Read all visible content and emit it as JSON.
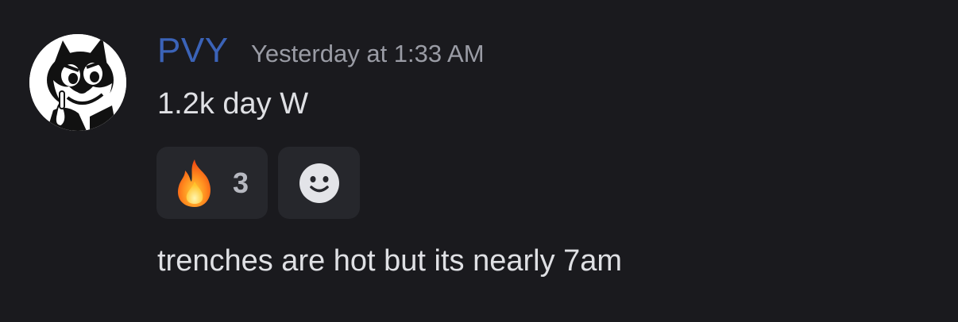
{
  "message": {
    "author": {
      "name": "PVY",
      "avatar_icon": "felix-cat-avatar-icon",
      "name_color": "#3b63b8"
    },
    "timestamp": "Yesterday at 1:33 AM",
    "content": "1.2k day W",
    "reactions": [
      {
        "emoji_icon": "fire-emoji-icon",
        "count": "3"
      }
    ],
    "add_reaction_icon": "smiley-face-icon",
    "followup_content": "trenches are hot but its nearly 7am"
  },
  "colors": {
    "background": "#1a1a1e",
    "text": "#dfe0e4",
    "muted": "#9a9ca5",
    "reaction_bg": "#26272c"
  }
}
